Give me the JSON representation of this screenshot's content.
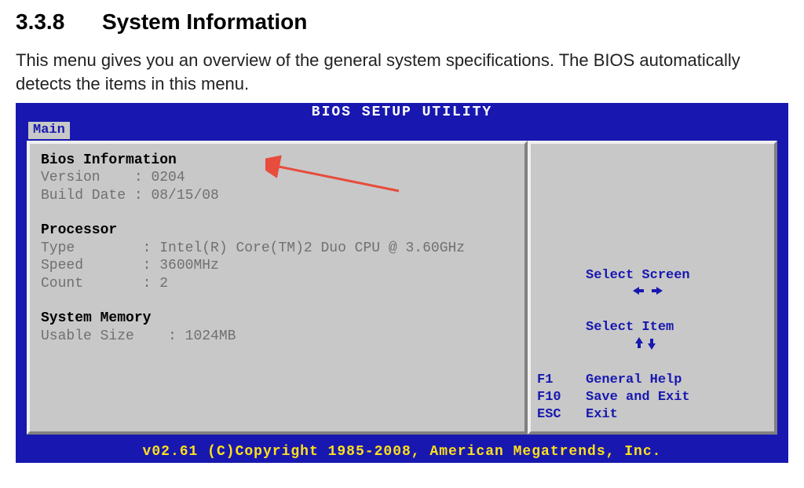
{
  "doc": {
    "section_number": "3.3.8",
    "section_title": "System Information",
    "intro": "This menu gives you an overview of the general system specifications. The BIOS automatically detects the items in this menu."
  },
  "bios": {
    "title": "BIOS SETUP UTILITY",
    "tab_main": "Main",
    "footer": "v02.61 (C)Copyright 1985-2008, American Megatrends, Inc.",
    "sections": {
      "bios_info": {
        "heading": "Bios Information",
        "version_label": "Version    : ",
        "version_value": "0204",
        "builddate_label": "Build Date : ",
        "builddate_value": "08/15/08"
      },
      "processor": {
        "heading": "Processor",
        "type_label": "Type        : ",
        "type_value": "Intel(R) Core(TM)2 Duo CPU @ 3.60GHz",
        "speed_label": "Speed       : ",
        "speed_value": "3600MHz",
        "count_label": "Count       : ",
        "count_value": "2"
      },
      "memory": {
        "heading": "System Memory",
        "usable_label": "Usable Size    : ",
        "usable_value": "1024MB"
      }
    },
    "help": {
      "select_screen": "Select Screen",
      "select_item": "Select Item",
      "f1_key": "F1",
      "f1_label": "General Help",
      "f10_key": "F10",
      "f10_label": "Save and Exit",
      "esc_key": "ESC",
      "esc_label": "Exit"
    }
  }
}
